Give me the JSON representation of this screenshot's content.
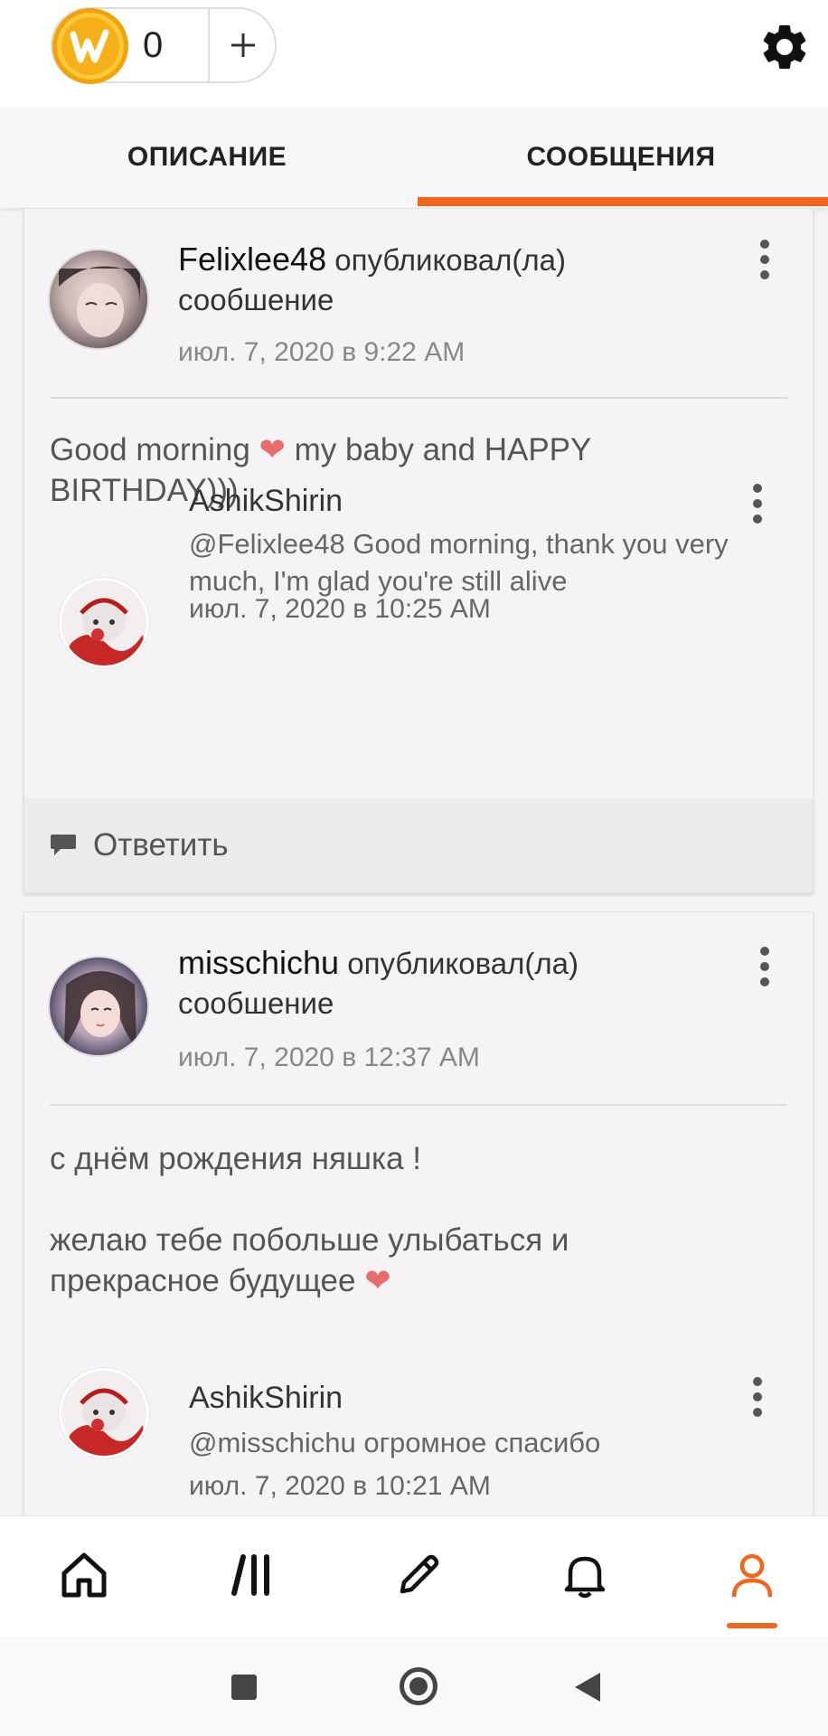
{
  "header": {
    "coin_icon": "wattpad-coin-icon",
    "coin_count": "0",
    "add_coins_label": "+",
    "settings_icon": "gear-icon"
  },
  "tabs": [
    {
      "label": "ОПИСАНИЕ",
      "active": false
    },
    {
      "label": "СООБЩЕНИЯ",
      "active": true
    }
  ],
  "colors": {
    "accent": "#f2661c",
    "coin": "#f6b11a",
    "heart": "#e76d6d"
  },
  "posts": [
    {
      "username": "Felixlee48",
      "action": "опубликовал(ла) сообшение",
      "date": "июл. 7, 2020 в 9:22 AM",
      "body_before_heart": "Good morning",
      "heart": "❤",
      "body_after_heart": " my baby and HAPPY BIRTHDAY)))",
      "reply": {
        "username": "AshikShirin",
        "text": "@Felixlee48  Good morning, thank you very much, I'm glad you're still alive",
        "date": "июл. 7, 2020 в 10:25 AM"
      },
      "reply_action": "Ответить"
    },
    {
      "username": "misschichu",
      "action": "опубликовал(ла) сообшение",
      "date": "июл. 7, 2020 в 12:37 AM",
      "line1": "с днём рождения няшка !",
      "line2": "желаю тебе побольше улыбаться и прекрасное будущее",
      "heart": "❤",
      "reply": {
        "username": "AshikShirin",
        "text": "@misschichu  огромное спасибо",
        "date": "июл. 7, 2020 в 10:21 AM"
      }
    }
  ],
  "bottom_nav": [
    {
      "name": "home-icon",
      "active": false
    },
    {
      "name": "library-icon",
      "active": false
    },
    {
      "name": "pencil-icon",
      "active": false
    },
    {
      "name": "bell-icon",
      "active": false
    },
    {
      "name": "profile-icon",
      "active": true
    }
  ],
  "system_nav": [
    "recents-button",
    "home-button",
    "back-button"
  ]
}
